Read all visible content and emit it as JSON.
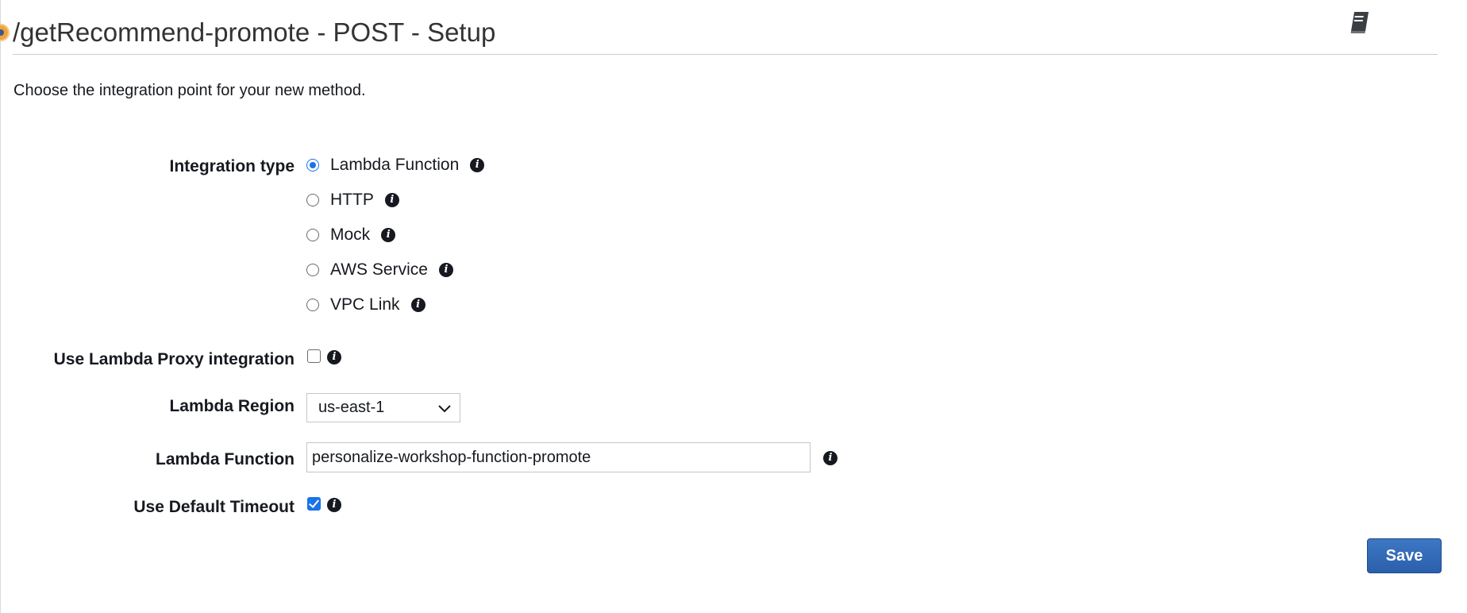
{
  "header": {
    "title": "/getRecommend-promote - POST - Setup",
    "docs_icon": "book-icon"
  },
  "intro_text": "Choose the integration point for your new method.",
  "integration_type": {
    "label": "Integration type",
    "selected": "Lambda Function",
    "options": [
      {
        "label": "Lambda Function",
        "checked": true
      },
      {
        "label": "HTTP",
        "checked": false
      },
      {
        "label": "Mock",
        "checked": false
      },
      {
        "label": "AWS Service",
        "checked": false
      },
      {
        "label": "VPC Link",
        "checked": false
      }
    ]
  },
  "lambda_proxy": {
    "label": "Use Lambda Proxy integration",
    "checked": false
  },
  "lambda_region": {
    "label": "Lambda Region",
    "value": "us-east-1"
  },
  "lambda_function": {
    "label": "Lambda Function",
    "value": "personalize-workshop-function-promote"
  },
  "default_timeout": {
    "label": "Use Default Timeout",
    "checked": true
  },
  "actions": {
    "save_label": "Save"
  },
  "colors": {
    "accent": "#1a73e8",
    "save_button": "#2f66b3",
    "marker": "#f0a340"
  },
  "info_glyph": "i"
}
